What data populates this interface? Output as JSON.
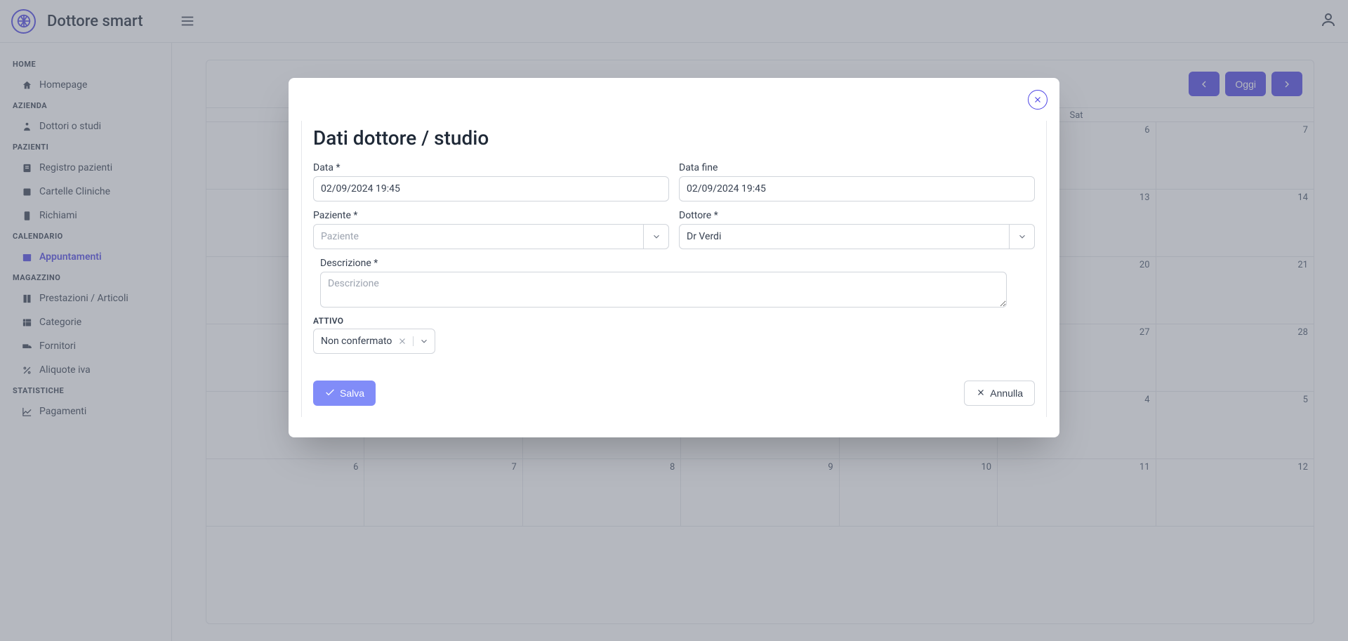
{
  "app": {
    "title": "Dottore smart"
  },
  "sidebar": {
    "sections": [
      {
        "title": "HOME",
        "items": [
          {
            "label": "Homepage",
            "icon": "home",
            "active": false
          }
        ]
      },
      {
        "title": "AZIENDA",
        "items": [
          {
            "label": "Dottori o studi",
            "icon": "doctor",
            "active": false
          }
        ]
      },
      {
        "title": "PAZIENTI",
        "items": [
          {
            "label": "Registro pazienti",
            "icon": "patients",
            "active": false
          },
          {
            "label": "Cartelle Cliniche",
            "icon": "folder",
            "active": false
          },
          {
            "label": "Richiami",
            "icon": "phone",
            "active": false
          }
        ]
      },
      {
        "title": "CALENDARIO",
        "items": [
          {
            "label": "Appuntamenti",
            "icon": "calendar",
            "active": true
          }
        ]
      },
      {
        "title": "MAGAZZINO",
        "items": [
          {
            "label": "Prestazioni / Articoli",
            "icon": "book",
            "active": false
          },
          {
            "label": "Categorie",
            "icon": "table",
            "active": false
          },
          {
            "label": "Fornitori",
            "icon": "truck",
            "active": false
          },
          {
            "label": "Aliquote iva",
            "icon": "percent",
            "active": false
          }
        ]
      },
      {
        "title": "STATISTICHE",
        "items": [
          {
            "label": "Pagamenti",
            "icon": "chart",
            "active": false
          }
        ]
      }
    ]
  },
  "calendar": {
    "today_label": "Oggi",
    "day_headers": [
      "",
      "",
      "",
      "",
      "",
      "Sat",
      ""
    ],
    "rows": [
      [
        "",
        "",
        "",
        "",
        "",
        "6",
        "7"
      ],
      [
        "",
        "",
        "",
        "",
        "",
        "13",
        "14"
      ],
      [
        "",
        "",
        "",
        "",
        "",
        "20",
        "21"
      ],
      [
        "",
        "",
        "",
        "",
        "",
        "27",
        "28"
      ],
      [
        "",
        "",
        "",
        "",
        "",
        "4",
        "5"
      ],
      [
        "6",
        "7",
        "8",
        "9",
        "10",
        "11",
        "12"
      ]
    ]
  },
  "modal": {
    "title": "Dati dottore / studio",
    "fields": {
      "data": {
        "label": "Data *",
        "value": "02/09/2024 19:45"
      },
      "data_fine": {
        "label": "Data fine",
        "value": "02/09/2024 19:45"
      },
      "paziente": {
        "label": "Paziente *",
        "placeholder": "Paziente",
        "value": ""
      },
      "dottore": {
        "label": "Dottore *",
        "value": "Dr Verdi"
      },
      "descrizione": {
        "label": "Descrizione *",
        "placeholder": "Descrizione",
        "value": ""
      }
    },
    "attivo": {
      "label": "ATTIVO",
      "value": "Non confermato"
    },
    "buttons": {
      "save": "Salva",
      "cancel": "Annulla"
    }
  }
}
